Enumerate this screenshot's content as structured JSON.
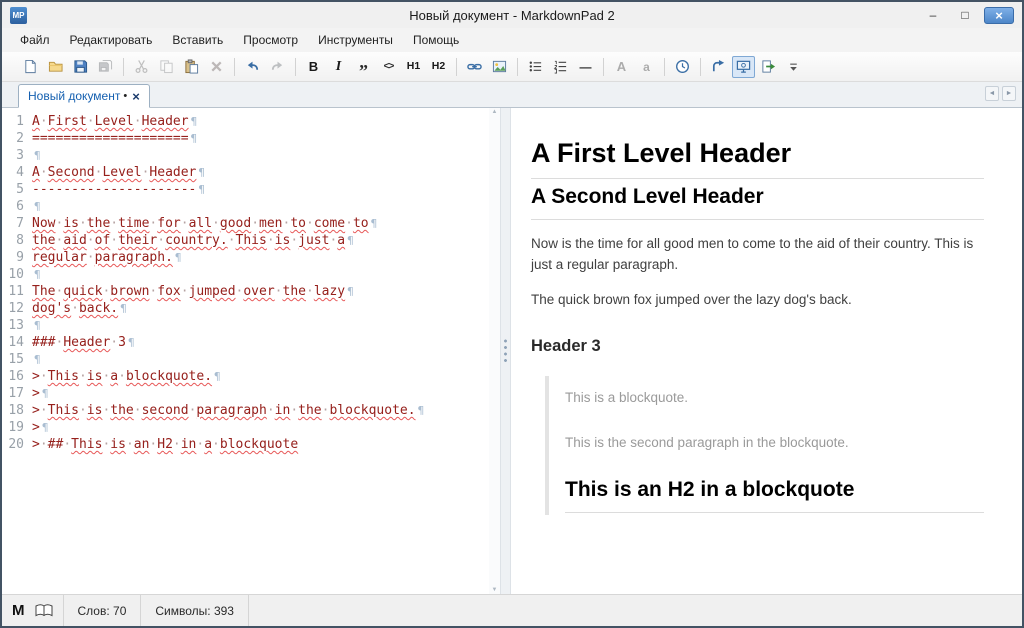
{
  "window": {
    "title": "Новый документ - MarkdownPad 2",
    "logo_text": "MP",
    "controls": {
      "minimize": "–",
      "maximize": "□",
      "close": "×"
    }
  },
  "menu": {
    "items": [
      {
        "id": "file",
        "label": "Файл"
      },
      {
        "id": "edit",
        "label": "Редактировать"
      },
      {
        "id": "insert",
        "label": "Вставить"
      },
      {
        "id": "view",
        "label": "Просмотр"
      },
      {
        "id": "tools",
        "label": "Инструменты"
      },
      {
        "id": "help",
        "label": "Помощь"
      }
    ]
  },
  "toolbar": {
    "items": [
      {
        "name": "new-document",
        "icon": "page"
      },
      {
        "name": "open-file",
        "icon": "folder"
      },
      {
        "name": "save",
        "icon": "save"
      },
      {
        "name": "save-all",
        "icon": "saveall",
        "disabled": true
      },
      {
        "sep": true
      },
      {
        "name": "cut",
        "icon": "cut",
        "disabled": true
      },
      {
        "name": "copy",
        "icon": "copy",
        "disabled": true
      },
      {
        "name": "paste",
        "icon": "paste"
      },
      {
        "name": "delete",
        "icon": "delete",
        "disabled": true
      },
      {
        "sep": true
      },
      {
        "name": "undo",
        "icon": "undo"
      },
      {
        "name": "redo",
        "icon": "redo",
        "disabled": true
      },
      {
        "sep": true
      },
      {
        "name": "bold",
        "glyph": "B"
      },
      {
        "name": "italic",
        "glyph": "I"
      },
      {
        "name": "blockquote",
        "glyph": "”"
      },
      {
        "name": "code",
        "glyph": "<>"
      },
      {
        "name": "heading-1",
        "glyph": "H1"
      },
      {
        "name": "heading-2",
        "glyph": "H2"
      },
      {
        "sep": true
      },
      {
        "name": "hyperlink",
        "icon": "link"
      },
      {
        "name": "image",
        "icon": "image"
      },
      {
        "sep": true
      },
      {
        "name": "bullet-list",
        "icon": "ul"
      },
      {
        "name": "numbered-list",
        "icon": "ol"
      },
      {
        "name": "horizontal-rule",
        "glyph": "—"
      },
      {
        "sep": true
      },
      {
        "name": "uppercase",
        "glyph": "A",
        "disabled": true
      },
      {
        "name": "lowercase",
        "glyph": "a",
        "disabled": true
      },
      {
        "sep": true
      },
      {
        "name": "timestamp",
        "icon": "clock"
      },
      {
        "sep": true
      },
      {
        "name": "jump-to-preview",
        "icon": "goto"
      },
      {
        "name": "live-preview",
        "icon": "monitor",
        "active": true
      },
      {
        "name": "export",
        "icon": "export"
      },
      {
        "name": "toolbar-options",
        "icon": "overflow"
      }
    ]
  },
  "tab": {
    "label": "Новый документ",
    "modified_indicator": "•",
    "close_glyph": "×"
  },
  "tab_scroll": {
    "left": "◄",
    "right": "►"
  },
  "scrollbar": {
    "up": "▲",
    "down": "▼"
  },
  "editor": {
    "lines": [
      "A First Level Header",
      "====================",
      "",
      "A Second Level Header",
      "---------------------",
      "",
      "Now is the time for all good men to come to",
      "the aid of their country. This is just a",
      "regular paragraph.",
      "",
      "The quick brown fox jumped over the lazy",
      "dog's back.",
      "",
      "### Header 3",
      "",
      "> This is a blockquote.",
      ">",
      "> This is the second paragraph in the blockquote.",
      ">",
      "> ## This is an H2 in a blockquote"
    ]
  },
  "preview": {
    "blocks": [
      {
        "type": "h1",
        "text": "A First Level Header"
      },
      {
        "type": "h2",
        "text": "A Second Level Header"
      },
      {
        "type": "p",
        "text": "Now is the time for all good men to come to the aid of their country. This is just a regular paragraph."
      },
      {
        "type": "p",
        "text": "The quick brown fox jumped over the lazy dog's back."
      },
      {
        "type": "h3",
        "text": "Header 3"
      },
      {
        "type": "blockquote",
        "items": [
          {
            "type": "p",
            "text": "This is a blockquote."
          },
          {
            "type": "p",
            "text": "This is the second paragraph in the blockquote."
          },
          {
            "type": "h2",
            "text": "This is an H2 in a blockquote"
          }
        ]
      }
    ]
  },
  "statusbar": {
    "markdown_icon": "M",
    "words": "Слов: 70",
    "chars": "Символы: 393"
  }
}
